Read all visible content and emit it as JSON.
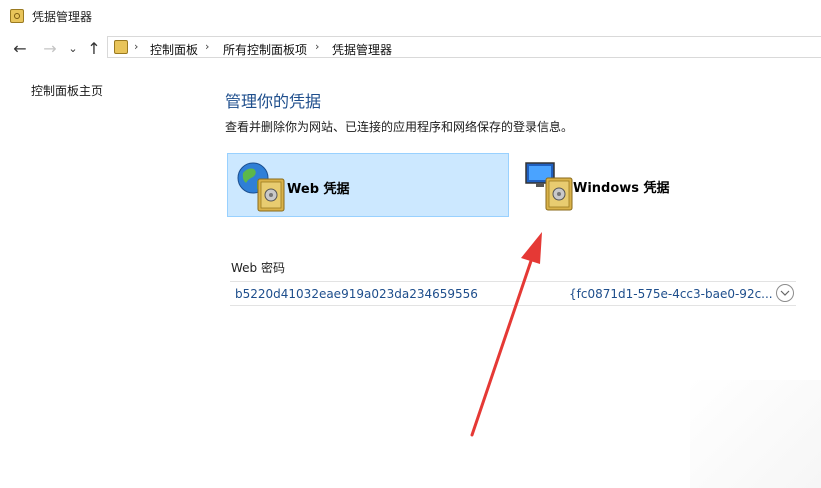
{
  "window": {
    "title": "凭据管理器"
  },
  "breadcrumb": [
    "控制面板",
    "所有控制面板项",
    "凭据管理器"
  ],
  "sidebar": {
    "home_link": "控制面板主页"
  },
  "main": {
    "title": "管理你的凭据",
    "description": "查看并删除你为网站、已连接的应用程序和网络保存的登录信息。",
    "tiles": [
      {
        "label": "Web 凭据",
        "selected": true
      },
      {
        "label": "Windows 凭据",
        "selected": false
      }
    ],
    "section": {
      "header": "Web 密码",
      "rows": [
        {
          "name": "b5220d41032eae919a023da234659556",
          "detail": "{fc0871d1-575e-4cc3-bae0-92c..."
        }
      ]
    }
  },
  "colors": {
    "accent_text": "#1e4e8c",
    "selection_bg": "#cce8ff",
    "arrow": "#e53935"
  }
}
